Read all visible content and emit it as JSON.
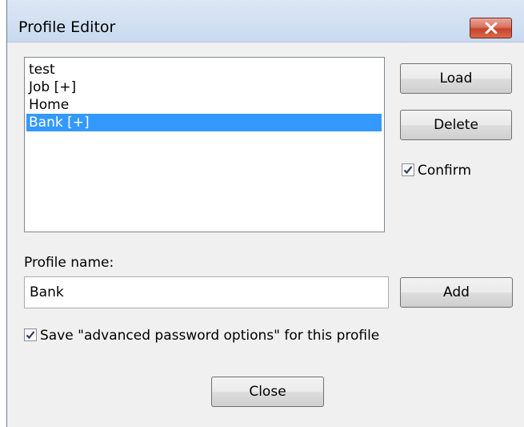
{
  "window": {
    "title": "Profile Editor"
  },
  "profiles": {
    "items": [
      "test",
      "Job [+]",
      "Home",
      "Bank [+]"
    ],
    "selected_index": 3
  },
  "buttons": {
    "load": "Load",
    "delete": "Delete",
    "add": "Add",
    "close": "Close"
  },
  "confirm": {
    "label": "Confirm",
    "checked": true
  },
  "profile_name": {
    "label": "Profile name:",
    "value": "Bank"
  },
  "save_advanced": {
    "label": "Save \"advanced password options\" for this profile",
    "checked": true
  },
  "colors": {
    "selection": "#3399ff",
    "close_button": "#c7442b"
  },
  "icons": {
    "close": "close-icon",
    "check": "checkmark-icon"
  }
}
